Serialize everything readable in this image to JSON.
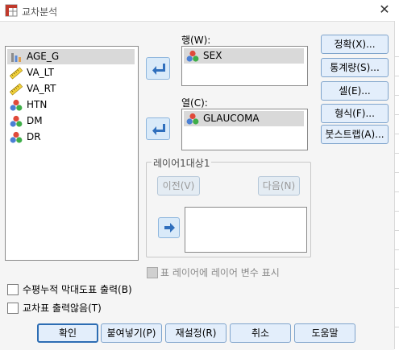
{
  "window": {
    "title": "교차분석",
    "close_glyph": "✕"
  },
  "variables": [
    {
      "name": "AGE_G",
      "icon": "nominal-bars-icon",
      "selected": true
    },
    {
      "name": "VA_LT",
      "icon": "scale-ruler-icon",
      "selected": false
    },
    {
      "name": "VA_RT",
      "icon": "scale-ruler-icon",
      "selected": false
    },
    {
      "name": "HTN",
      "icon": "nominal-balls-icon",
      "selected": false
    },
    {
      "name": "DM",
      "icon": "nominal-balls-icon",
      "selected": false
    },
    {
      "name": "DR",
      "icon": "nominal-balls-icon",
      "selected": false
    }
  ],
  "rows": {
    "label": "행(W):",
    "items": [
      {
        "name": "SEX",
        "icon": "nominal-balls-icon"
      }
    ]
  },
  "columns": {
    "label": "열(C):",
    "items": [
      {
        "name": "GLAUCOMA",
        "icon": "nominal-balls-icon"
      }
    ]
  },
  "layer": {
    "title": "레이어1대상1",
    "prev_label": "이전(V)",
    "next_label": "다음(N)",
    "display_layer_label": "표 레이어에 레이어 변수 표시"
  },
  "side_buttons": {
    "exact": "정확(X)...",
    "statistics": "통계량(S)...",
    "cells": "셀(E)...",
    "format": "형식(F)...",
    "bootstrap": "붓스트랩(A)..."
  },
  "options": {
    "clustered_bar": "수평누적 막대도표 출력(B)",
    "suppress_tables": "교차표 출력않음(T)"
  },
  "bottom_buttons": {
    "ok": "확인",
    "paste": "붙여넣기(P)",
    "reset": "재설정(R)",
    "cancel": "취소",
    "help": "도움말"
  },
  "colors": {
    "accent": "#2d6db3",
    "arrow_blue": "#2f6fbd",
    "selected_row": "#d9d9d9",
    "dialog_bg": "#f5f5f5"
  }
}
